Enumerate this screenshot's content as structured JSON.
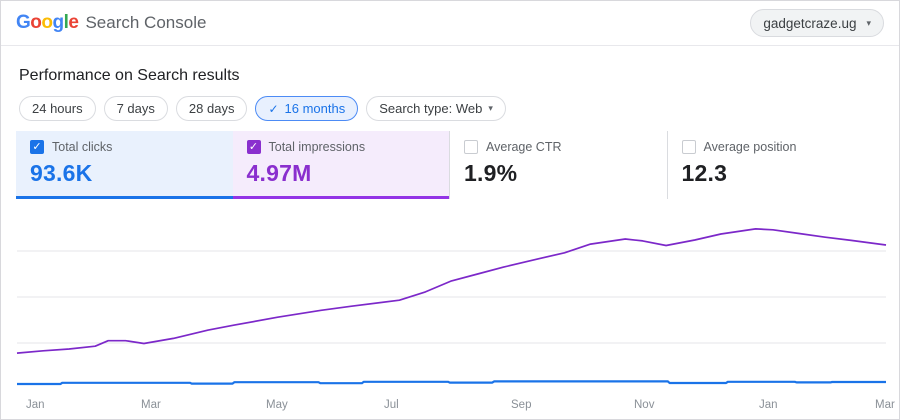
{
  "header": {
    "logo_letters": [
      {
        "ch": "G",
        "color": "#4285F4"
      },
      {
        "ch": "o",
        "color": "#EA4335"
      },
      {
        "ch": "o",
        "color": "#FBBC05"
      },
      {
        "ch": "g",
        "color": "#4285F4"
      },
      {
        "ch": "l",
        "color": "#34A853"
      },
      {
        "ch": "e",
        "color": "#EA4335"
      }
    ],
    "product_name": "Search Console",
    "property_selector": {
      "value": "gadgetcraze.ug",
      "caret": "▾"
    }
  },
  "page": {
    "title": "Performance on Search results"
  },
  "filters": {
    "chips": [
      {
        "label": "24 hours",
        "selected": false
      },
      {
        "label": "7 days",
        "selected": false
      },
      {
        "label": "28 days",
        "selected": false
      },
      {
        "label": "16 months",
        "selected": true,
        "check_glyph": "✓"
      },
      {
        "label": "Search type: Web",
        "selected": false,
        "caret": "▾"
      }
    ]
  },
  "metrics": {
    "check_glyph": "✓",
    "cards": [
      {
        "label": "Total clicks",
        "value": "93.6K",
        "checked": true,
        "accent": "#1a73e8",
        "bg": "#e9f1fd",
        "border": "#1a73e8"
      },
      {
        "label": "Total impressions",
        "value": "4.97M",
        "checked": true,
        "accent": "#8a2fce",
        "bg": "#f5ecfc",
        "border": "#9334e6"
      },
      {
        "label": "Average CTR",
        "value": "1.9%",
        "checked": false
      },
      {
        "label": "Average position",
        "value": "12.3",
        "checked": false
      }
    ]
  },
  "chart_data": {
    "type": "line",
    "title": "Performance on Search results — 16 months",
    "xlabel": "",
    "ylabel": "",
    "grid_on": true,
    "grid_color": "#e5e5e9",
    "axis_text_color": "#8a9097",
    "x_axis_labels": [
      {
        "label": "Jan",
        "f": 0.0104
      },
      {
        "label": "Mar",
        "f": 0.1427
      },
      {
        "label": "May",
        "f": 0.2865
      },
      {
        "label": "Jul",
        "f": 0.4223
      },
      {
        "label": "Sep",
        "f": 0.5685
      },
      {
        "label": "Nov",
        "f": 0.71
      },
      {
        "label": "Jan",
        "f": 0.8539
      },
      {
        "label": "Mar",
        "f": 0.9873
      }
    ],
    "grid_values_impressions": [
      5000,
      10000,
      15000
    ],
    "series": [
      {
        "name": "Total impressions",
        "total": "4.97M",
        "unit": "impressions per day",
        "color": "#7c28c9",
        "ymin": 0,
        "ymax": 20000,
        "points": [
          [
            0,
            3900
          ],
          [
            0.03,
            4150
          ],
          [
            0.06,
            4350
          ],
          [
            0.09,
            4650
          ],
          [
            0.105,
            5250
          ],
          [
            0.125,
            5250
          ],
          [
            0.146,
            4950
          ],
          [
            0.18,
            5500
          ],
          [
            0.22,
            6400
          ],
          [
            0.25,
            6950
          ],
          [
            0.3,
            7800
          ],
          [
            0.35,
            8550
          ],
          [
            0.385,
            9000
          ],
          [
            0.44,
            9650
          ],
          [
            0.47,
            10550
          ],
          [
            0.5,
            11750
          ],
          [
            0.53,
            12500
          ],
          [
            0.56,
            13250
          ],
          [
            0.6,
            14150
          ],
          [
            0.63,
            14800
          ],
          [
            0.66,
            15750
          ],
          [
            0.7,
            16300
          ],
          [
            0.72,
            16100
          ],
          [
            0.747,
            15600
          ],
          [
            0.78,
            16200
          ],
          [
            0.81,
            16850
          ],
          [
            0.85,
            17400
          ],
          [
            0.87,
            17300
          ],
          [
            0.9,
            16900
          ],
          [
            0.93,
            16500
          ],
          [
            0.96,
            16150
          ],
          [
            1,
            15650
          ]
        ]
      },
      {
        "name": "Total clicks",
        "total": "93.6K",
        "unit": "clicks per day",
        "color": "#1a73e8",
        "ymin": 0,
        "ymax": 5600,
        "points": [
          [
            0,
            152
          ],
          [
            0.05,
            152
          ],
          [
            0.052,
            189
          ],
          [
            0.199,
            189
          ],
          [
            0.201,
            164
          ],
          [
            0.248,
            164
          ],
          [
            0.25,
            207
          ],
          [
            0.347,
            207
          ],
          [
            0.349,
            177
          ],
          [
            0.397,
            177
          ],
          [
            0.399,
            219
          ],
          [
            0.496,
            219
          ],
          [
            0.498,
            195
          ],
          [
            0.547,
            195
          ],
          [
            0.549,
            231
          ],
          [
            0.749,
            231
          ],
          [
            0.751,
            183
          ],
          [
            0.816,
            183
          ],
          [
            0.818,
            219
          ],
          [
            0.895,
            219
          ],
          [
            0.897,
            201
          ],
          [
            0.936,
            201
          ],
          [
            0.938,
            213
          ],
          [
            1,
            213
          ]
        ]
      }
    ]
  }
}
